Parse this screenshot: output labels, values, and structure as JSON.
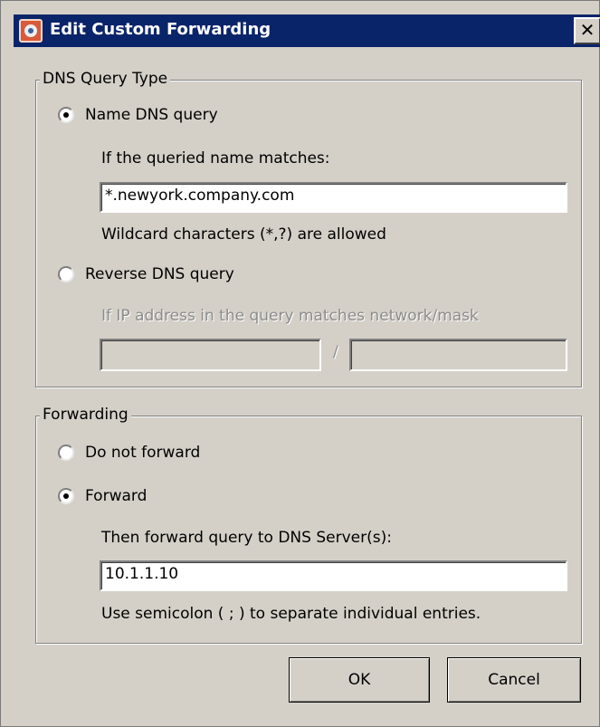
{
  "window": {
    "title": "Edit Custom Forwarding",
    "close_symbol": "✕"
  },
  "dns_query_type": {
    "legend": "DNS Query Type",
    "name_query": {
      "label": "Name DNS query",
      "checked": true,
      "match_prompt": "If the queried name matches:",
      "value": "*.newyork.company.com",
      "hint": "Wildcard characters (*,?) are allowed"
    },
    "reverse_query": {
      "label": "Reverse DNS query",
      "checked": false,
      "match_prompt": "If IP address in the query matches network/mask",
      "network_value": "",
      "separator": "/",
      "mask_value": ""
    }
  },
  "forwarding": {
    "legend": "Forwarding",
    "do_not_forward": {
      "label": "Do not forward",
      "checked": false
    },
    "forward": {
      "label": "Forward",
      "checked": true,
      "prompt": "Then forward query to DNS Server(s):",
      "value": "10.1.1.10",
      "hint": "Use semicolon ( ; ) to separate individual entries."
    }
  },
  "buttons": {
    "ok": "OK",
    "cancel": "Cancel"
  }
}
